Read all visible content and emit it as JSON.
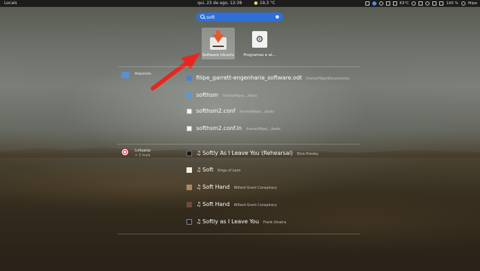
{
  "topbar": {
    "activities": "Locais",
    "clock": "qui, 23 de ago, 12:38",
    "weather": "19,3 °C",
    "temperature": "63°C",
    "battery": "100 %",
    "user": "filipe"
  },
  "search": {
    "value": "soft"
  },
  "apps": [
    {
      "label": "Software Ubuntu",
      "icon": "software-center-icon",
      "selected": true
    },
    {
      "label": "Programas e at...",
      "icon": "settings-icon",
      "selected": false
    }
  ],
  "files": {
    "provider": "Arquivos",
    "results": [
      {
        "title": "filipe_garrett-engenharia_software.odt",
        "path": "/home/filipe/Documentos",
        "icon": "document-icon"
      },
      {
        "title": "softhsm",
        "path": "/home/filipe/.../tests",
        "icon": "folder-icon"
      },
      {
        "title": "softhsm2.conf",
        "path": "/home/filipe/.../tests",
        "icon": "text-file-icon"
      },
      {
        "title": "softhsm2.conf.in",
        "path": "/home/filipe/.../tests",
        "icon": "text-file-icon"
      }
    ]
  },
  "music": {
    "provider": "Lollypop",
    "more": "+ 3 mais",
    "results": [
      {
        "note": "♫",
        "title": "Softly As I Leave You (Rehearsal)",
        "artist": "Elvis Presley",
        "icon": "album-icon"
      },
      {
        "note": "♫",
        "title": "Soft",
        "artist": "Kings of Leon",
        "icon": "album-icon"
      },
      {
        "note": "♫",
        "title": "Soft Hand",
        "artist": "Willard Grant Conspiracy",
        "icon": "album-icon"
      },
      {
        "note": "♫",
        "title": "Soft Hand",
        "artist": "Willard Grant Conspiracy",
        "icon": "album-icon"
      },
      {
        "note": "♫",
        "title": "Softly as I Leave You",
        "artist": "Frank Sinatra",
        "icon": "album-icon"
      }
    ]
  },
  "colors": {
    "search_bg": "#2f6fd6",
    "arrow": "#e8261f"
  }
}
